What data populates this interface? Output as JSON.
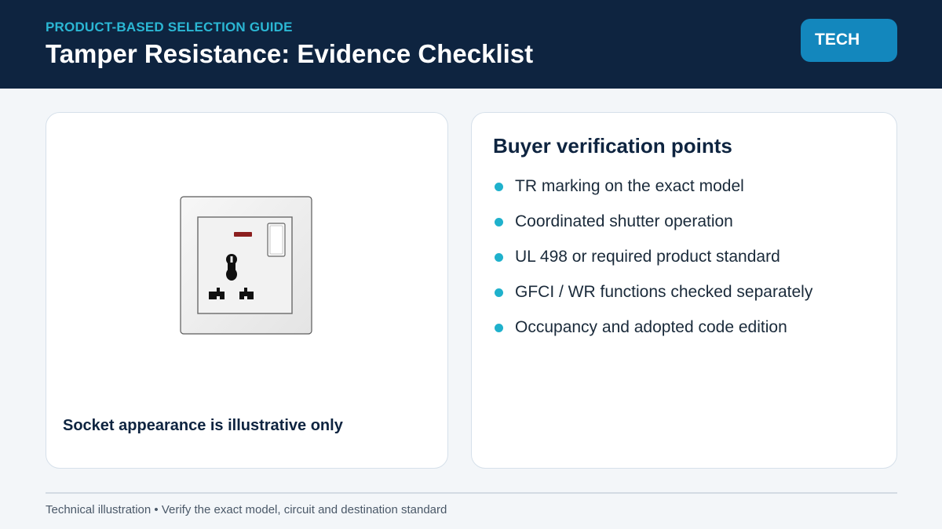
{
  "header": {
    "eyebrow": "PRODUCT-BASED SELECTION GUIDE",
    "title": "Tamper Resistance: Evidence Checklist",
    "badge": "TECH"
  },
  "illustration": {
    "caption": "Socket appearance is illustrative only",
    "icon": "universal-socket-illustration"
  },
  "checklist": {
    "title": "Buyer verification points",
    "items": [
      "TR marking on the exact model",
      "Coordinated shutter operation",
      "UL 498 or required product standard",
      "GFCI / WR functions checked separately",
      "Occupancy and adopted code edition"
    ]
  },
  "footer": {
    "note": "Technical illustration • Verify the exact model, circuit and destination standard"
  },
  "colors": {
    "header_bg": "#0e2440",
    "accent_cyan": "#2bb7d4",
    "badge_bg": "#1387bd",
    "bullet": "#1fb1cc"
  }
}
